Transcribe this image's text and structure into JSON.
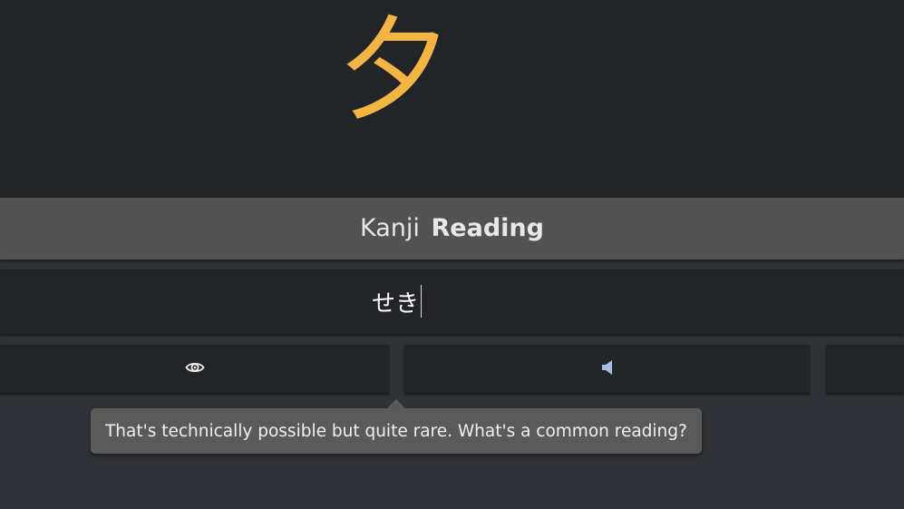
{
  "prompt": {
    "character": "夕"
  },
  "banner": {
    "subject_type": "Kanji",
    "question_type": "Reading"
  },
  "answer": {
    "value": "せき"
  },
  "buttons": [
    {
      "icon": "eye-icon",
      "label": ""
    },
    {
      "icon": "speaker-icon",
      "label": ""
    },
    {
      "icon": "",
      "label": ""
    }
  ],
  "tooltip": {
    "text": "That's technically possible but quite rare. What's a common reading?"
  },
  "colors": {
    "kanji": "#f5b544",
    "background": "#222427",
    "banner": "#525252",
    "tooltip": "#5a5a5a",
    "speaker_icon": "#a9bce8"
  }
}
